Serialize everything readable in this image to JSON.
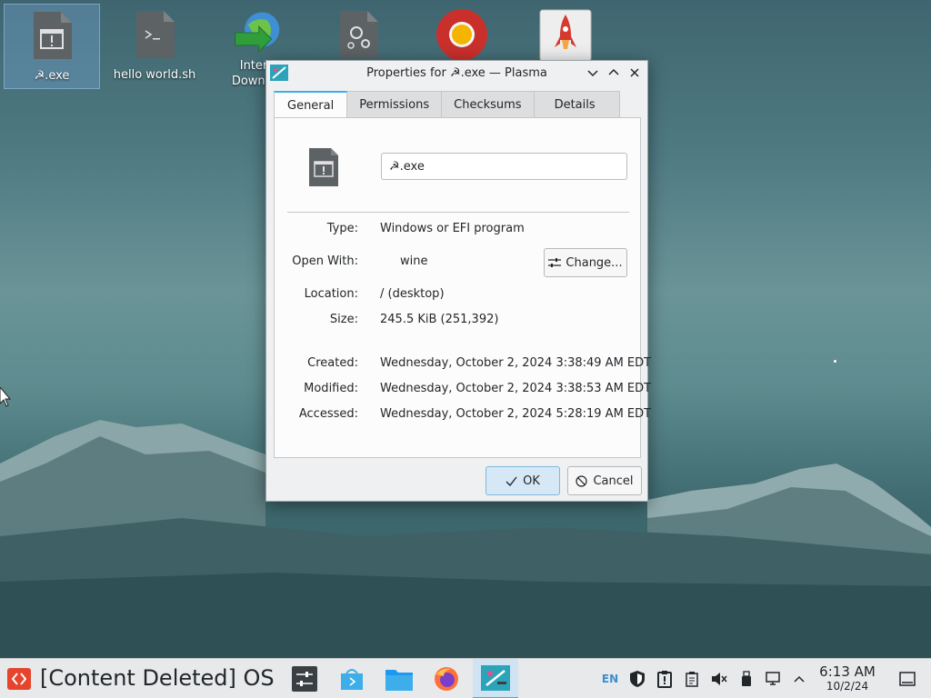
{
  "desktop": {
    "icons": [
      {
        "label": "☭.exe",
        "icon": "executable-file-icon"
      },
      {
        "label": "hello world.sh",
        "icon": "shell-script-icon"
      },
      {
        "label": "Internet Download Manager",
        "label_line1": "Intern",
        "label_line2": "Downloa",
        "icon": "idm-icon"
      },
      {
        "label": "",
        "icon": "settings-file-icon"
      },
      {
        "label": "",
        "icon": "chrome-icon"
      },
      {
        "label": "",
        "icon": "rocket-app-icon"
      }
    ]
  },
  "dialog": {
    "title": "Properties for ☭.exe — Plasma",
    "tabs": [
      {
        "label": "General",
        "active": true
      },
      {
        "label": "Permissions",
        "active": false
      },
      {
        "label": "Checksums",
        "active": false
      },
      {
        "label": "Details",
        "active": false
      }
    ],
    "name_value": "☭.exe",
    "fields": {
      "type_label": "Type:",
      "type_value": "Windows or EFI program",
      "open_with_label": "Open With:",
      "open_with_value": "wine",
      "change_label": "Change...",
      "location_label": "Location:",
      "location_value": "/ (desktop)",
      "size_label": "Size:",
      "size_value": "245.5 KiB (251,392)",
      "created_label": "Created:",
      "created_value": "Wednesday, October 2, 2024 3:38:49 AM EDT",
      "modified_label": "Modified:",
      "modified_value": "Wednesday, October 2, 2024 3:38:53 AM EDT",
      "accessed_label": "Accessed:",
      "accessed_value": "Wednesday, October 2, 2024 5:28:19 AM EDT"
    },
    "ok_label": "OK",
    "cancel_label": "Cancel"
  },
  "taskbar": {
    "os_label": "[Content Deleted] OS",
    "language": "EN",
    "time": "6:13 AM",
    "date": "10/2/24"
  },
  "colors": {
    "accent": "#3daee9",
    "launcher": "#e6442d",
    "dialog_bg": "#eff0f1"
  }
}
